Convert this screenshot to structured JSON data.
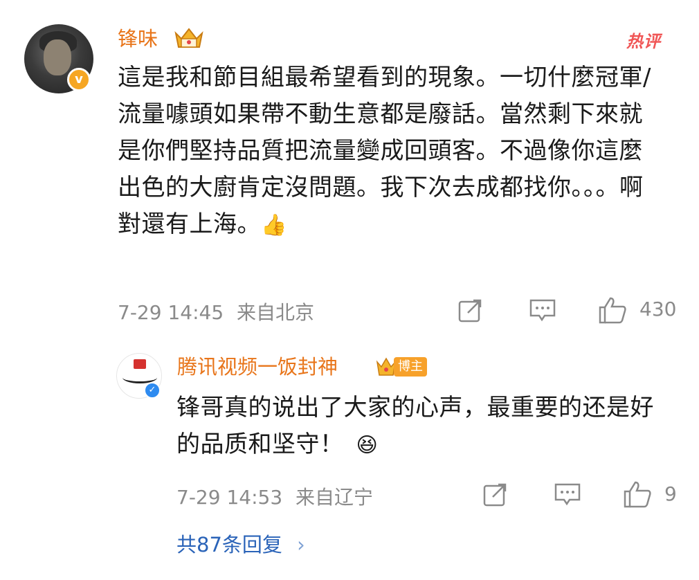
{
  "comment": {
    "author": "锋味",
    "hot_label": "热评",
    "verified_mark": "v",
    "text": "這是我和節目組最希望看到的現象。一切什麼冠軍/流量噱頭如果帶不動生意都是廢話。當然剩下來就是你們堅持品質把流量變成回頭客。不過像你這麼出色的大廚肯定沒問題。我下次去成都找你。。。啊對還有上海。",
    "emoji": "👍",
    "time": "7-29 14:45",
    "location": "来自北京",
    "likes": "430"
  },
  "reply": {
    "author": "腾讯视频一饭封神",
    "host_badge": "博主",
    "verified_mark": "✓",
    "text": "锋哥真的说出了大家的心声，最重要的还是好的品质和坚守！",
    "emoji": "😆",
    "time": "7-29 14:53",
    "location": "来自辽宁",
    "likes": "9"
  },
  "footer": {
    "more_replies": "共87条回复",
    "chevron": "›"
  },
  "colors": {
    "name": "#e8751a",
    "link": "#2a63b8",
    "meta": "#8a8a8a",
    "hot": "#f05656"
  }
}
